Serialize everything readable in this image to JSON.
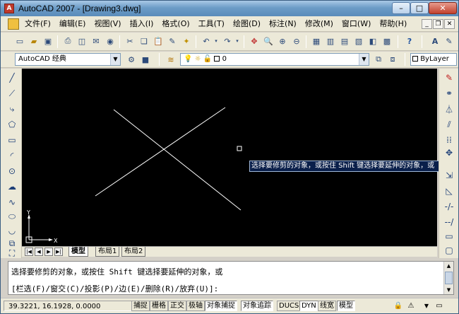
{
  "window": {
    "title": "AutoCAD 2007 - [Drawing3.dwg]",
    "app_icon": "autocad-icon",
    "controls": [
      "minimize-icon",
      "maximize-icon",
      "close-icon"
    ]
  },
  "menu": {
    "items": [
      {
        "label": "文件(F)"
      },
      {
        "label": "编辑(E)"
      },
      {
        "label": "视图(V)"
      },
      {
        "label": "插入(I)"
      },
      {
        "label": "格式(O)"
      },
      {
        "label": "工具(T)"
      },
      {
        "label": "绘图(D)"
      },
      {
        "label": "标注(N)"
      },
      {
        "label": "修改(M)"
      },
      {
        "label": "窗口(W)"
      },
      {
        "label": "帮助(H)"
      }
    ],
    "doc_controls": [
      "doc-minimize-icon",
      "doc-restore-icon",
      "doc-close-icon"
    ]
  },
  "workspace": {
    "selected": "AutoCAD 经典"
  },
  "layers": {
    "current_layer": "0",
    "color_value": "ByLayer"
  },
  "layout_tabs": [
    {
      "label": "模型",
      "active": true
    },
    {
      "label": "布局1",
      "active": false
    },
    {
      "label": "布局2",
      "active": false
    }
  ],
  "drawing": {
    "tooltip": "选择要修剪的对象，或按住 Shift 键选择要延伸的对象，或",
    "ucs_x": "X",
    "ucs_y": "Y"
  },
  "command": {
    "line1": "选择要修剪的对象，或按住 Shift 键选择要延伸的对象，或",
    "line2": "[栏选(F)/窗交(C)/投影(P)/边(E)/删除(R)/放弃(U)]:"
  },
  "status": {
    "coords": "39.3221, 16.1928, 0.0000",
    "buttons": [
      {
        "label": "捕捉",
        "on": false
      },
      {
        "label": "栅格",
        "on": false
      },
      {
        "label": "正交",
        "on": false
      },
      {
        "label": "极轴",
        "on": false
      },
      {
        "label": "对象捕捉",
        "on": true
      },
      {
        "label": "对象追踪",
        "on": true
      },
      {
        "label": "DUCS",
        "on": false
      },
      {
        "label": "DYN",
        "on": true
      },
      {
        "label": "线宽",
        "on": false
      },
      {
        "label": "模型",
        "on": true
      }
    ]
  },
  "accent": {
    "canvas_bg": "#000000",
    "tooltip_bg": "#0a1f4a",
    "title_bar": "#6c9cc7"
  }
}
